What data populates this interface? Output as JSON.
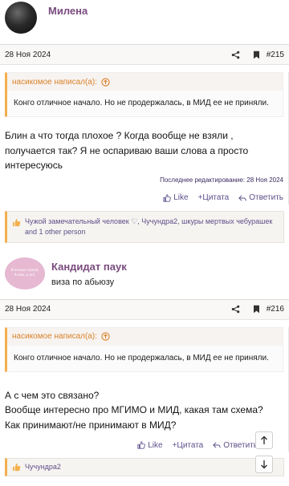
{
  "post1": {
    "username": "Милена",
    "date": "28 Ноя 2024",
    "number": "#215",
    "quote_author": "насикомое написал(а):",
    "quote_text": "Конго отличное начало. Но не продержалась, в МИД ее не приняли.",
    "message": "Блин а что тогда плохое ? Когда вообще не взяли , получается так? Я не оспариваю ваши слова а просто интересуюсь",
    "edited": "Последнее редактирование: 28 Ноя 2024",
    "actions": {
      "like": "Like",
      "quote": "+Цитата",
      "reply": "Ответить"
    },
    "reactions": "Чужой замечательный человек ♡, Чучундра2, шкуры мертвых чебурашек and 1 other person"
  },
  "post2": {
    "username": "Кандидат паук",
    "user_title": "виза по абьюзу",
    "avatar_text": "Я только тупой. А так, я всё.",
    "date": "28 Ноя 2024",
    "number": "#216",
    "quote_author": "насикомое написал(а):",
    "quote_text": "Конго отличное начало. Но не продержалась, в МИД ее не приняли.",
    "message": "А с чем это связано?\nВообще интересно про МГИМО и МИД, какая там схема?\nКак принимают/не принимают в МИД?",
    "actions": {
      "like": "Like",
      "quote": "+Цитата",
      "reply": "Ответить"
    },
    "reactions": "Чучундра2"
  },
  "icons": {
    "share": "share-icon",
    "bookmark": "bookmark-icon",
    "quote_expand": "arrow-up-circle-icon",
    "like": "thumbs-up-icon",
    "reply": "reply-icon",
    "scroll_up": "arrow-up-icon",
    "scroll_down": "arrow-down-icon"
  },
  "colors": {
    "username": "#7a4b7f",
    "quote_accent": "#f2b04f",
    "quote_author": "#d9822b",
    "action": "#5d4e8a"
  }
}
